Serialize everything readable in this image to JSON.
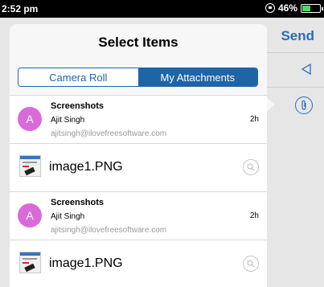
{
  "status_bar": {
    "time": "2:52 pm",
    "battery": "46%",
    "battery_fraction": 0.46
  },
  "background": {
    "send_label": "Send"
  },
  "popover": {
    "title": "Select Items",
    "segments": [
      {
        "label": "Camera Roll",
        "active": false
      },
      {
        "label": "My Attachments",
        "active": true
      }
    ],
    "items": [
      {
        "type": "email",
        "avatar_letter": "A",
        "subject": "Screenshots",
        "sender": "Ajit Singh",
        "address": "ajitsingh@ilovefreesoftware.com",
        "time": "2h"
      },
      {
        "type": "file",
        "name": "image1.PNG"
      },
      {
        "type": "email",
        "avatar_letter": "A",
        "subject": "Screenshots",
        "sender": "Ajit Singh",
        "address": "ajitsingh@ilovefreesoftware.com",
        "time": "2h"
      },
      {
        "type": "file",
        "name": "image1.PNG"
      }
    ]
  },
  "colors": {
    "accent": "#1f64a6",
    "avatar": "#d86bd8",
    "battery": "#4cd964"
  }
}
